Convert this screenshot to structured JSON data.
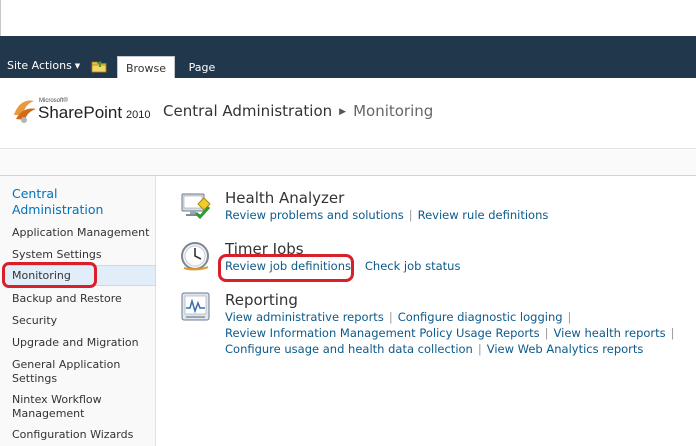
{
  "ribbon": {
    "site_actions": "Site Actions",
    "tabs": [
      {
        "label": "Browse",
        "selected": true
      },
      {
        "label": "Page",
        "selected": false
      }
    ]
  },
  "header": {
    "logo_small": "Microsoft®",
    "logo_product": "SharePoint",
    "logo_version": "2010",
    "breadcrumb": [
      "Central Administration",
      "Monitoring"
    ]
  },
  "leftnav": {
    "heading": "Central Administration",
    "items": [
      {
        "label": "Application Management"
      },
      {
        "label": "System Settings"
      },
      {
        "label": "Monitoring",
        "selected": true
      },
      {
        "label": "Backup and Restore"
      },
      {
        "label": "Security"
      },
      {
        "label": "Upgrade and Migration"
      },
      {
        "label": "General Application Settings"
      },
      {
        "label": "Nintex Workflow Management"
      },
      {
        "label": "Configuration Wizards"
      }
    ]
  },
  "sections": [
    {
      "title": "Health Analyzer",
      "icon": "health-analyzer-icon",
      "lines": [
        [
          "Review problems and solutions",
          "Review rule definitions"
        ]
      ]
    },
    {
      "title": "Timer Jobs",
      "icon": "clock-icon",
      "lines": [
        [
          "Review job definitions",
          "Check job status"
        ]
      ]
    },
    {
      "title": "Reporting",
      "icon": "reporting-icon",
      "lines": [
        [
          "View administrative reports",
          "Configure diagnostic logging"
        ],
        [
          "Review Information Management Policy Usage Reports",
          "View health reports"
        ],
        [
          "Configure usage and health data collection",
          "View Web Analytics reports"
        ]
      ]
    }
  ],
  "colors": {
    "ribbon": "#21374c",
    "link": "#0c5a8a",
    "nav_heading": "#0072bc",
    "highlight": "#d8202a"
  }
}
